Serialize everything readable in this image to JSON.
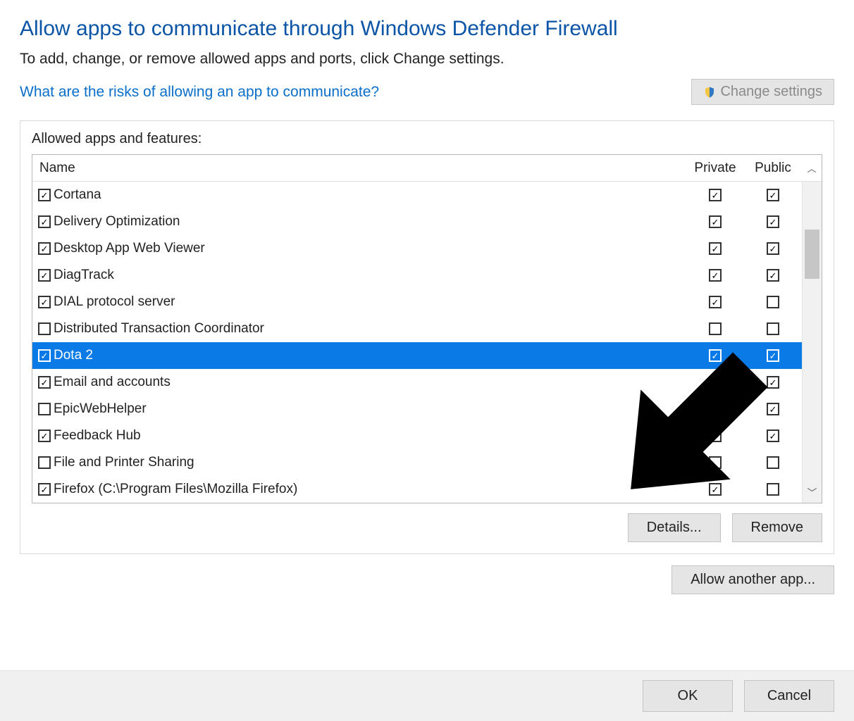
{
  "title": "Allow apps to communicate through Windows Defender Firewall",
  "subtitle": "To add, change, or remove allowed apps and ports, click Change settings.",
  "risk_link": "What are the risks of allowing an app to communicate?",
  "change_settings_label": "Change settings",
  "panel_label": "Allowed apps and features:",
  "columns": {
    "name": "Name",
    "private": "Private",
    "public": "Public"
  },
  "rows": [
    {
      "enabled": true,
      "name": "Cortana",
      "private": true,
      "public": true,
      "selected": false
    },
    {
      "enabled": true,
      "name": "Delivery Optimization",
      "private": true,
      "public": true,
      "selected": false
    },
    {
      "enabled": true,
      "name": "Desktop App Web Viewer",
      "private": true,
      "public": true,
      "selected": false
    },
    {
      "enabled": true,
      "name": "DiagTrack",
      "private": true,
      "public": true,
      "selected": false
    },
    {
      "enabled": true,
      "name": "DIAL protocol server",
      "private": true,
      "public": false,
      "selected": false
    },
    {
      "enabled": false,
      "name": "Distributed Transaction Coordinator",
      "private": false,
      "public": false,
      "selected": false
    },
    {
      "enabled": true,
      "name": "Dota 2",
      "private": true,
      "public": true,
      "selected": true
    },
    {
      "enabled": true,
      "name": "Email and accounts",
      "private": true,
      "public": true,
      "selected": false
    },
    {
      "enabled": false,
      "name": "EpicWebHelper",
      "private": true,
      "public": true,
      "selected": false
    },
    {
      "enabled": true,
      "name": "Feedback Hub",
      "private": true,
      "public": true,
      "selected": false
    },
    {
      "enabled": false,
      "name": "File and Printer Sharing",
      "private": false,
      "public": false,
      "selected": false
    },
    {
      "enabled": true,
      "name": "Firefox (C:\\Program Files\\Mozilla Firefox)",
      "private": true,
      "public": false,
      "selected": false
    }
  ],
  "buttons": {
    "details": "Details...",
    "remove": "Remove",
    "allow_another": "Allow another app...",
    "ok": "OK",
    "cancel": "Cancel"
  }
}
